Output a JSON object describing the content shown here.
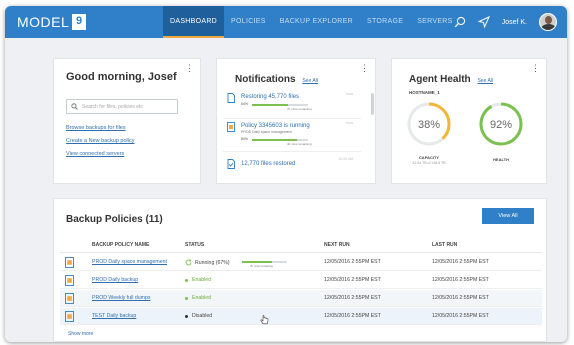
{
  "header": {
    "logo_text": "MODEL",
    "logo_box": "9",
    "nav": [
      {
        "label": "DASHBOARD",
        "active": true
      },
      {
        "label": "POLICIES",
        "active": false
      },
      {
        "label": "BACKUP EXPLORER",
        "active": false
      },
      {
        "label": "STORAGE",
        "active": false
      },
      {
        "label": "SERVERS",
        "active": false
      }
    ],
    "user_name": "Josef K."
  },
  "greeting": {
    "title": "Good morning, Josef",
    "search_placeholder": "Search for files, policies etc",
    "links": [
      "Browse backups for files",
      "Create a New backup policy",
      "View connected servers"
    ]
  },
  "notifications": {
    "title": "Notifications",
    "see_all": "See All",
    "items": [
      {
        "title": "Restoring 45,770 files",
        "time": "Now",
        "pct": "64%",
        "progress": 0.64,
        "remaining": "7b mins remaining"
      },
      {
        "title": "Policy 3345603 is running",
        "time": "Now",
        "sub": "PROD Daily space management",
        "pct": "80%",
        "progress": 0.8,
        "remaining": "4b mins remaining"
      },
      {
        "title": "12,770 files restored",
        "time": "12:00 AM"
      }
    ]
  },
  "agent_health": {
    "title": "Agent Health",
    "see_all": "See All",
    "hostname": "HOSTNAME_1",
    "capacity": {
      "value": "38%",
      "fraction": 0.38,
      "label": "CAPACITY",
      "sub": "42.54 TB of 148.8 TB"
    },
    "health": {
      "value": "92%",
      "fraction": 0.92,
      "label": "HEALTH"
    }
  },
  "policies": {
    "title": "Backup Policies (11)",
    "view_all": "View All",
    "columns": [
      "BACKUP POLICY NAME",
      "STATUS",
      "NEXT RUN",
      "LAST RUN"
    ],
    "rows": [
      {
        "name": "PROD Daily space management",
        "status": "Running (67%)",
        "state": "running",
        "progress": 0.67,
        "remaining": "7b mins remaining",
        "next": "12/05/2016 2:55PM EST",
        "last": "12/05/2016 2:55PM EST"
      },
      {
        "name": "PROD Daily backup",
        "status": "Enabled",
        "state": "enabled",
        "next": "12/05/2016 2:55PM EST",
        "last": "12/05/2016 2:55PM EST"
      },
      {
        "name": "PROD Weekly full dumps",
        "status": "Enabled",
        "state": "enabled",
        "next": "12/05/2016 2:55PM EST",
        "last": "12/05/2016 2:55PM EST"
      },
      {
        "name": "TEST Daily backup",
        "status": "Disabled",
        "state": "disabled",
        "next": "12/05/2016 2:55PM EST",
        "last": "12/05/2016 2:55PM EST"
      }
    ],
    "show_more": "Show more"
  },
  "colors": {
    "brand": "#2f80c8",
    "nav_active": "#1f5f9c",
    "accent": "#f0a940",
    "success": "#7cc04f",
    "gauge_capacity": "#f3b53a",
    "gauge_health": "#7cc04f",
    "disabled": "#333333"
  },
  "icons": {
    "search": "search-icon",
    "location": "location-arrow-icon",
    "file": "file-icon",
    "policy": "policy-document-icon",
    "check": "file-check-icon",
    "refresh": "refresh-icon",
    "more": "kebab-menu-icon"
  }
}
